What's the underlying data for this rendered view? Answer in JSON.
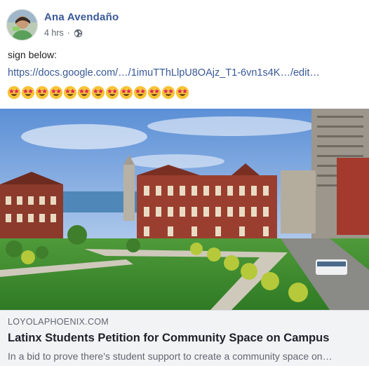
{
  "post": {
    "author": "Ana Avendaño",
    "time": "4 hrs",
    "dot": "·",
    "privacy_icon": "globe-icon",
    "text": "sign below:",
    "link": "https://docs.google.com/…/1imuTThLlpU8OAjz_T1-6vn1s4K…/edit…",
    "emoji_icon": "star-struck-emoji",
    "emoji_count": 13
  },
  "preview": {
    "domain": "LOYOLAPHOENIX.COM",
    "title": "Latinx Students Petition for Community Space on Campus",
    "description": "In a bid to prove there's student support to create a community space on…"
  },
  "colors": {
    "link": "#385898",
    "secondary_text": "#606770",
    "preview_bg": "#f2f3f5"
  }
}
